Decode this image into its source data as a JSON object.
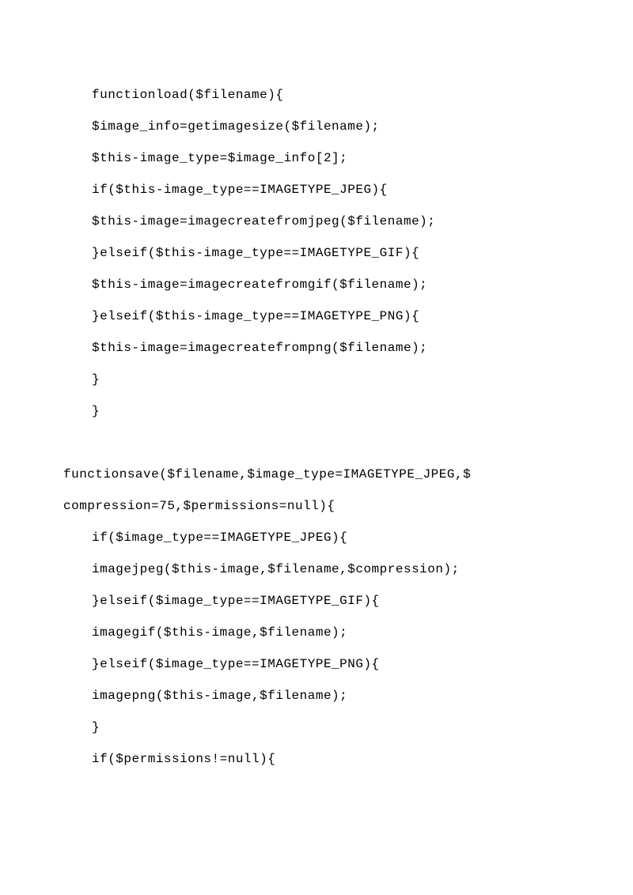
{
  "lines": [
    {
      "indent": true,
      "text": "functionload($filename){"
    },
    {
      "indent": true,
      "text": "$image_info=getimagesize($filename);"
    },
    {
      "indent": true,
      "text": "$this-image_type=$image_info[2];"
    },
    {
      "indent": true,
      "text": "if($this-image_type==IMAGETYPE_JPEG){"
    },
    {
      "indent": true,
      "text": "$this-image=imagecreatefromjpeg($filename);"
    },
    {
      "indent": true,
      "text": "}elseif($this-image_type==IMAGETYPE_GIF){"
    },
    {
      "indent": true,
      "text": "$this-image=imagecreatefromgif($filename);"
    },
    {
      "indent": true,
      "text": "}elseif($this-image_type==IMAGETYPE_PNG){"
    },
    {
      "indent": true,
      "text": "$this-image=imagecreatefrompng($filename);"
    },
    {
      "indent": true,
      "text": "}"
    },
    {
      "indent": true,
      "text": "}"
    },
    {
      "blank": true
    },
    {
      "indent": false,
      "text": "functionsave($filename,$image_type=IMAGETYPE_JPEG,$"
    },
    {
      "indent": false,
      "text": "compression=75,$permissions=null){"
    },
    {
      "indent": true,
      "text": "if($image_type==IMAGETYPE_JPEG){"
    },
    {
      "indent": true,
      "text": "imagejpeg($this-image,$filename,$compression);"
    },
    {
      "indent": true,
      "text": "}elseif($image_type==IMAGETYPE_GIF){"
    },
    {
      "indent": true,
      "text": "imagegif($this-image,$filename);"
    },
    {
      "indent": true,
      "text": "}elseif($image_type==IMAGETYPE_PNG){"
    },
    {
      "indent": true,
      "text": "imagepng($this-image,$filename);"
    },
    {
      "indent": true,
      "text": "}"
    },
    {
      "indent": true,
      "text": "if($permissions!=null){"
    }
  ]
}
